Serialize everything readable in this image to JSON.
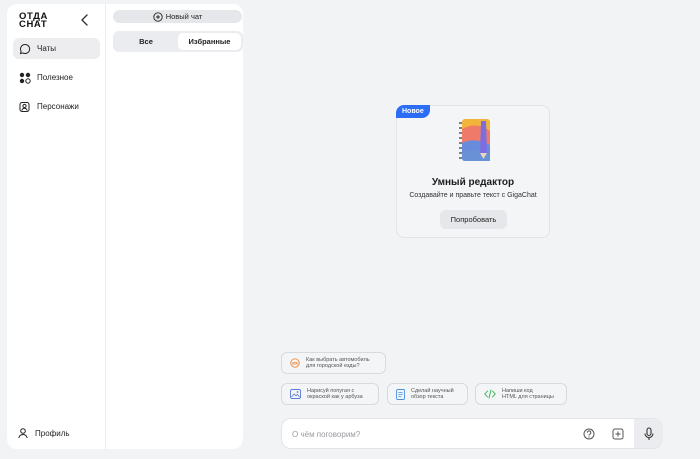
{
  "app": {
    "logo_line1": "ОТДА",
    "logo_line2": "СНАТ"
  },
  "nav": {
    "items": [
      {
        "label": "Чаты",
        "icon": "chat-bubble-icon",
        "active": true
      },
      {
        "label": "Полезное",
        "icon": "apps-grid-icon",
        "active": false
      },
      {
        "label": "Персонажи",
        "icon": "characters-icon",
        "active": false
      }
    ],
    "profile_label": "Профиль"
  },
  "panel": {
    "new_chat_label": "Новый чат",
    "filter_tabs": [
      {
        "label": "Все",
        "selected": false
      },
      {
        "label": "Избранные",
        "selected": true
      }
    ]
  },
  "promo": {
    "badge": "Новое",
    "title": "Умный редактор",
    "subtitle": "Создавайте и правьте текст с GigaChat",
    "button": "Попробовать",
    "badge_color": "#2b6ef5"
  },
  "suggestions": [
    {
      "line1": "Как выбрать автомобиль",
      "line2": "для городской езды?",
      "icon": "car-question-icon",
      "color": "#f0893a"
    },
    {
      "line1": "Нарисуй попугая с",
      "line2": "окраской как у арбуза",
      "icon": "image-icon",
      "color": "#5b7bd6"
    },
    {
      "line1": "Сделай научный",
      "line2": "обзор текста",
      "icon": "document-icon",
      "color": "#4a90e2"
    },
    {
      "line1": "Напиши код",
      "line2": "HTML для страницы",
      "icon": "code-icon",
      "color": "#2fae4a"
    }
  ],
  "composer": {
    "placeholder": "О чём поговорим?",
    "icons": [
      "help-icon",
      "add-icon",
      "mic-icon"
    ]
  }
}
